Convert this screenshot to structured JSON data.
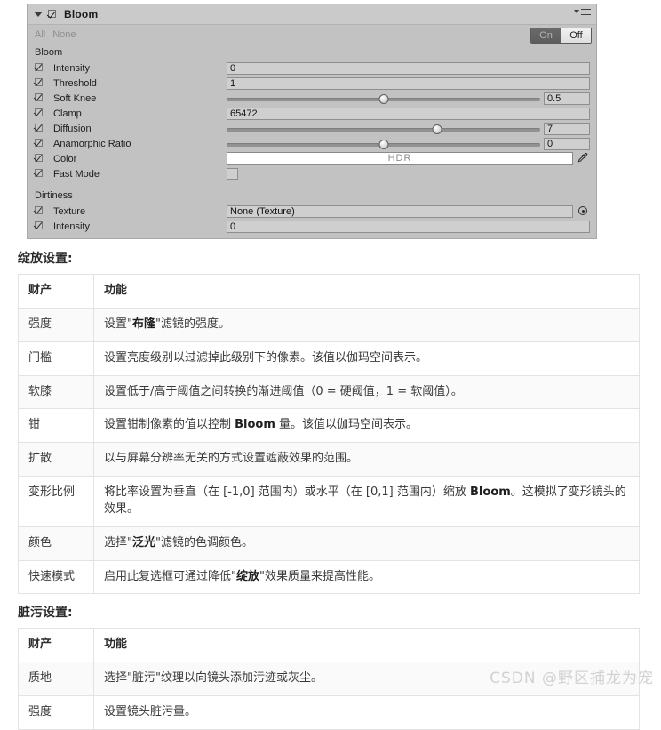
{
  "inspector": {
    "title": "Bloom",
    "foldout_icon": "triangle-down-icon",
    "menu_icon": "context-menu-icon",
    "quick_select": {
      "all_label": "All",
      "none_label": "None"
    },
    "toggle": {
      "on_label": "On",
      "off_label": "Off",
      "selected": "On"
    },
    "sections": [
      {
        "label": "Bloom",
        "rows": [
          {
            "name": "Intensity",
            "type": "field",
            "value": "0"
          },
          {
            "name": "Threshold",
            "type": "field",
            "value": "1"
          },
          {
            "name": "Soft Knee",
            "type": "slider",
            "value": "0.5",
            "fill_percent": 50
          },
          {
            "name": "Clamp",
            "type": "field",
            "value": "65472"
          },
          {
            "name": "Diffusion",
            "type": "slider",
            "value": "7",
            "fill_percent": 67
          },
          {
            "name": "Anamorphic Ratio",
            "type": "slider",
            "value": "0",
            "fill_percent": 50
          },
          {
            "name": "Color",
            "type": "color",
            "value": "HDR",
            "swatch_color": "#ffffff",
            "picker_icon": "eyedropper-icon"
          },
          {
            "name": "Fast Mode",
            "type": "checkbox",
            "value": ""
          }
        ]
      },
      {
        "label": "Dirtiness",
        "rows": [
          {
            "name": "Texture",
            "type": "object",
            "value": "None (Texture)",
            "picker_icon": "object-picker-icon"
          },
          {
            "name": "Intensity",
            "type": "field",
            "value": "0"
          }
        ]
      }
    ]
  },
  "doc": {
    "bloom_heading": "绽放设置:",
    "dirt_heading": "脏污设置:",
    "table_headers": {
      "property": "财产",
      "function": "功能"
    },
    "bloom_table": [
      {
        "property": "强度",
        "function": "设置\"<b>布隆</b>\"滤镜的强度。"
      },
      {
        "property": "门槛",
        "function": "设置亮度级别以过滤掉此级别下的像素。该值以伽玛空间表示。"
      },
      {
        "property": "软膝",
        "function": "设置低于/高于阈值之间转换的渐进阈值（0 = 硬阈值，1 = 软阈值）。"
      },
      {
        "property": "钳",
        "function": "设置钳制像素的值以控制 <b>Bloom</b> 量。该值以伽玛空间表示。"
      },
      {
        "property": "扩散",
        "function": "以与屏幕分辨率无关的方式设置遮蔽效果的范围。"
      },
      {
        "property": "变形比例",
        "function": "将比率设置为垂直（在 [-1,0] 范围内）或水平（在 [0,1] 范围内）缩放 <b>Bloom</b>。这模拟了变形镜头的效果。"
      },
      {
        "property": "颜色",
        "function": "选择\"<b>泛光</b>\"滤镜的色调颜色。"
      },
      {
        "property": "快速模式",
        "function": "启用此复选框可通过降低\"<b>绽放</b>\"效果质量来提高性能。"
      }
    ],
    "dirt_table": [
      {
        "property": "质地",
        "function": "选择\"脏污\"纹理以向镜头添加污迹或灰尘。"
      },
      {
        "property": "强度",
        "function": "设置镜头脏污量。"
      }
    ]
  },
  "watermark": "CSDN @野区捕龙为宠"
}
